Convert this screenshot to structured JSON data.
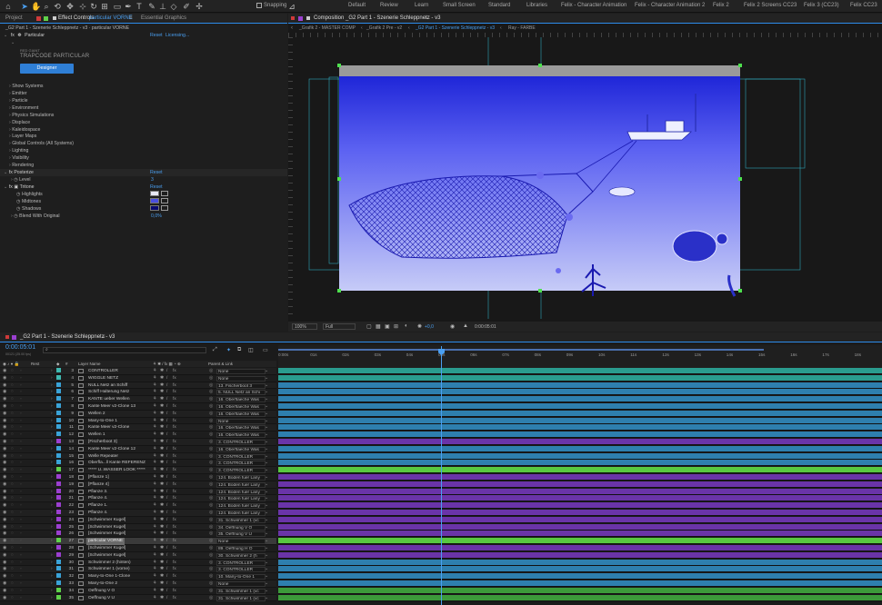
{
  "toolbar": {
    "snapping": "Snapping",
    "workspaces": [
      "Default",
      "Review",
      "Learn",
      "Small Screen",
      "Standard",
      "Libraries",
      "Felix - Character Animation",
      "Felix - Character Animation 2",
      "Felix 2",
      "Felix 2 Screens CC23",
      "Felix 3 (CC23)",
      "Felix CC23"
    ]
  },
  "left_panel": {
    "tab_project": "Project",
    "tab_effect": "Effect Controls",
    "tab_effect_layer": "particular VORNE",
    "tab_essential": "Essential Graphics",
    "breadcrumb": "_G2 Part 1 - Szenerie Schleppnetz - v3 · particular VORNE",
    "fx_particular": "Particular",
    "reset": "Reset",
    "licensing": "Licensing...",
    "redgiant": "RED GIANT",
    "brand": "TRAPCODE PARTICULAR",
    "designer": "Designer",
    "groups": [
      "Show Systems",
      "Emitter",
      "Particle",
      "Environment",
      "Physics Simulations",
      "Displace",
      "Kaleidospace",
      "Layer Maps",
      "Global Controls (All Systems)",
      "Lighting",
      "Visibility",
      "Rendering"
    ],
    "fx_posterize": "Posterize",
    "level_label": "Level",
    "level_value": "3",
    "fx_tritone": "Tritone",
    "highlights": "Highlights",
    "midtones": "Midtones",
    "shadows": "Shadows",
    "blend": "Blend With Original",
    "blend_value": "0,0%"
  },
  "comp_panel": {
    "tab": "Composition _G2 Part 1 - Szenerie Schleppnetz - v3",
    "subtabs": [
      "_Grafik 2 - MASTER COMP",
      "_Grafik 2 Pre - v2",
      "_G2 Part 1 - Szenerie Schleppnetz - v3",
      "Ray - FARBE"
    ],
    "zoom": "100%",
    "resolution": "Full",
    "exposure": "+0,0",
    "timecode": "0:00:05:01"
  },
  "timeline": {
    "tab": "_G2 Part 1 - Szenerie Schleppnetz - v3",
    "timecode": "0:00:05:01",
    "timecode_sub": "00121 (25.00 fps)",
    "col_layer": "Layer Name",
    "col_num": "#",
    "col_parent": "Parent & Link",
    "col_rest": "Rest",
    "ruler": [
      "0:00s",
      "01s",
      "02s",
      "03s",
      "04s",
      "05s",
      "06s",
      "07s",
      "08s",
      "09s",
      "10s",
      "11s",
      "12s",
      "13s",
      "14s",
      "15s",
      "16s",
      "17s",
      "18s"
    ],
    "layers": [
      {
        "n": "3",
        "name": "CONTROLLER",
        "parent": "None",
        "color": "#3fb8b0",
        "bar": "#2a9c8f"
      },
      {
        "n": "4",
        "name": "WIGGLE NETZ",
        "parent": "None",
        "color": "#3fb8b0",
        "bar": "#2a9c8f"
      },
      {
        "n": "5",
        "name": "NULL Netz an Schiff",
        "parent": "13. Fischerboot 3",
        "color": "#3aa3d8",
        "bar": "#2e7fae"
      },
      {
        "n": "6",
        "name": "Schiff Halterung Netz",
        "parent": "5. NULL Netz an Schi",
        "color": "#3aa3d8",
        "bar": "#2e7fae"
      },
      {
        "n": "7",
        "name": "KANTE ueber Wellen",
        "parent": "16. Oberflaeche Was",
        "color": "#3aa3d8",
        "bar": "#2e7fae"
      },
      {
        "n": "8",
        "name": "Kante Meer v2-Clone 13",
        "parent": "16. Oberflaeche Was",
        "color": "#3aa3d8",
        "bar": "#2e7fae"
      },
      {
        "n": "9",
        "name": "Wellen 2",
        "parent": "16. Oberflaeche Was",
        "color": "#3aa3d8",
        "bar": "#2e7fae"
      },
      {
        "n": "10",
        "name": "Many-to-One 1",
        "parent": "None",
        "color": "#3aa3d8",
        "bar": "#2e7fae"
      },
      {
        "n": "11",
        "name": "Kante Meer v2-Clone",
        "parent": "16. Oberflaeche Was",
        "color": "#3aa3d8",
        "bar": "#2e7fae"
      },
      {
        "n": "12",
        "name": "Wellen 1",
        "parent": "16. Oberflaeche Was",
        "color": "#3aa3d8",
        "bar": "#2e7fae"
      },
      {
        "n": "13",
        "name": "[Fischerboot 3]",
        "parent": "3. CONTROLLER",
        "color": "#9b3fd0",
        "bar": "#6a34a8"
      },
      {
        "n": "14",
        "name": "Kante Meer v2-Clone 12",
        "parent": "16. Oberflaeche Was",
        "color": "#3aa3d8",
        "bar": "#2e7fae"
      },
      {
        "n": "15",
        "name": "Welle Repeater",
        "parent": "3. CONTROLLER",
        "color": "#3aa3d8",
        "bar": "#2e7fae"
      },
      {
        "n": "16",
        "name": "Oberfla...ll Kante REFERENZ",
        "parent": "3. CONTROLLER",
        "color": "#3aa3d8",
        "bar": "#2e7fae"
      },
      {
        "n": "17",
        "name": "***** U..WASSER LOOK *****",
        "parent": "3. CONTROLLER",
        "color": "#5fd14a",
        "bar": "#58c840"
      },
      {
        "n": "18",
        "name": "[Pflanze 1]",
        "parent": "124. Boden fuer Lany",
        "color": "#9b3fd0",
        "bar": "#6a34a8"
      },
      {
        "n": "19",
        "name": "[Pflanze 4]",
        "parent": "124. Boden fuer Lany",
        "color": "#9b3fd0",
        "bar": "#6a34a8"
      },
      {
        "n": "20",
        "name": "Pflanze 3.",
        "parent": "124. Boden fuer Lany",
        "color": "#9b3fd0",
        "bar": "#6a34a8"
      },
      {
        "n": "21",
        "name": "Pflanze 4.",
        "parent": "124. Boden fuer Lany",
        "color": "#9b3fd0",
        "bar": "#6a34a8"
      },
      {
        "n": "22",
        "name": "Pflanze 1.",
        "parent": "124. Boden fuer Lany",
        "color": "#9b3fd0",
        "bar": "#6a34a8"
      },
      {
        "n": "23",
        "name": "Pflanze 4.",
        "parent": "124. Boden fuer Lany",
        "color": "#9b3fd0",
        "bar": "#6a34a8"
      },
      {
        "n": "24",
        "name": "[Schwimmer Kugel]",
        "parent": "31. Schwimmer 1 (vc",
        "color": "#9b3fd0",
        "bar": "#6a34a8"
      },
      {
        "n": "25",
        "name": "[Schwimmer Kugel]",
        "parent": "34. Oeffnung V O",
        "color": "#9b3fd0",
        "bar": "#6a34a8"
      },
      {
        "n": "26",
        "name": "[Schwimmer Kugel]",
        "parent": "35. Oeffnung V U",
        "color": "#9b3fd0",
        "bar": "#6a34a8"
      },
      {
        "n": "27",
        "name": "particular VORNE",
        "parent": "None",
        "color": "#5fd14a",
        "bar": "#58c840",
        "selected": true
      },
      {
        "n": "28",
        "name": "[Schwimmer Kugel]",
        "parent": "89. Oeffnung H O",
        "color": "#9b3fd0",
        "bar": "#6a34a8"
      },
      {
        "n": "29",
        "name": "[Schwimmer Kugel]",
        "parent": "30. Schwimmer 2 (h",
        "color": "#9b3fd0",
        "bar": "#6a34a8"
      },
      {
        "n": "30",
        "name": "Schwimmer 2 (hinten)",
        "parent": "3. CONTROLLER",
        "color": "#3aa3d8",
        "bar": "#2e7fae"
      },
      {
        "n": "31",
        "name": "Schwimmer 1 (vorne)",
        "parent": "3. CONTROLLER",
        "color": "#3aa3d8",
        "bar": "#2e7fae"
      },
      {
        "n": "32",
        "name": "Many-to-One 1-Clone",
        "parent": "10. Many-to-One 1",
        "color": "#3aa3d8",
        "bar": "#2e7fae"
      },
      {
        "n": "33",
        "name": "Many-to-One 2",
        "parent": "None",
        "color": "#3aa3d8",
        "bar": "#2e7fae"
      },
      {
        "n": "34",
        "name": "Oeffnung V O",
        "parent": "31. Schwimmer 1 (vc",
        "color": "#5fd14a",
        "bar": "#3c9a3a"
      },
      {
        "n": "35",
        "name": "Oeffnung V U",
        "parent": "31. Schwimmer 1 (vc",
        "color": "#5fd14a",
        "bar": "#3c9a3a"
      }
    ]
  },
  "colors": {
    "accent_blue": "#2d8ceb",
    "panel_bg": "#1e1e1e",
    "designer_button": "#2f7fd6"
  }
}
